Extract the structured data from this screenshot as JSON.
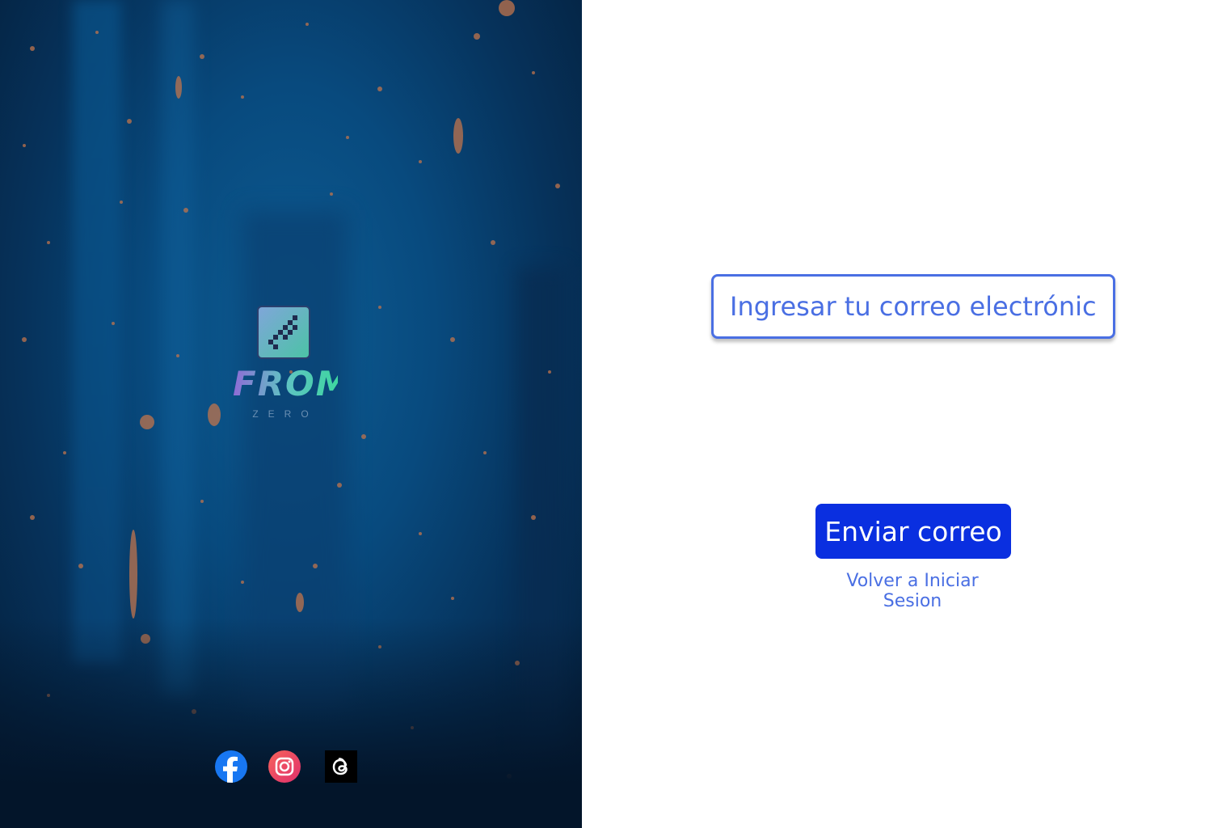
{
  "brand": {
    "logo_title": "FROM",
    "logo_subtitle": "ZERO"
  },
  "form": {
    "email_placeholder": "Ingresar tu correo electrónico",
    "submit_label": "Enviar correo",
    "back_link": "Volver a Iniciar Sesion"
  },
  "social": [
    {
      "icon": "facebook-icon"
    },
    {
      "icon": "instagram-icon"
    },
    {
      "icon": "threads-icon"
    }
  ],
  "colors": {
    "accent": "#4a6fe3",
    "button": "#0a2fe0"
  }
}
